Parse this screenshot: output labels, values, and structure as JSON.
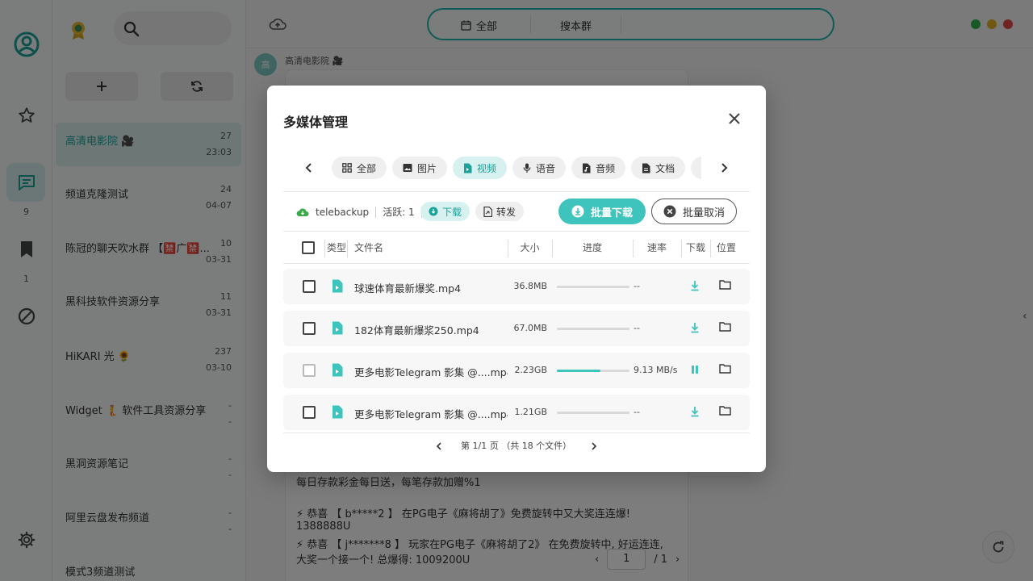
{
  "rail": {
    "chat_count": "9",
    "saved_count": "1"
  },
  "chatlist": {
    "items": [
      {
        "name": "高清电影院 🎥",
        "count": "27",
        "time": "23:03"
      },
      {
        "name": "频道克隆测试",
        "count": "24",
        "time": "04-07"
      },
      {
        "name": "陈冠的聊天吹水群 【🈲广🈲...",
        "count": "10",
        "time": "03-31"
      },
      {
        "name": "黑科技软件资源分享",
        "count": "11",
        "time": "03-31"
      },
      {
        "name": "HiKARI 光 🌻",
        "count": "237",
        "time": "03-10"
      },
      {
        "name": "Widget 🧜 软件工具资源分享",
        "count": "-",
        "time": "-"
      },
      {
        "name": "黑洞资源笔记",
        "count": "-",
        "time": "-"
      },
      {
        "name": "阿里云盘发布频道",
        "count": "-",
        "time": "-"
      },
      {
        "name": "模式3频道测试",
        "count": "",
        "time": ""
      }
    ]
  },
  "topbar": {
    "filter_all": "全部",
    "search_group": "搜本群"
  },
  "colors": {
    "accent": "#3ec4bc",
    "accent_dark": "#1aa29b",
    "win_green": "#2db34a",
    "win_yellow": "#e0b020",
    "win_red": "#e04848"
  },
  "message": {
    "sender": "高清电影院 🎥",
    "avatar_text": "高",
    "lines": [
      "每日存款彩金每日送，每笔存款加赠%1",
      "⚡ 恭喜 【 b*****2 】 在PG电子《麻将胡了》免费旋转中又大奖连连爆!",
      "1388888U",
      "⚡ 恭喜 【 j*******8 】 玩家在PG电子《麻将胡了2》 在免费旋转中, 好运连连,",
      "大奖一个接一个! 总爆得: 1009200U"
    ],
    "page_value": "1",
    "page_total": "/ 1"
  },
  "modal": {
    "title": "多媒体管理",
    "tabs": [
      {
        "label": "全部",
        "icon": "grid-icon"
      },
      {
        "label": "图片",
        "icon": "image-icon"
      },
      {
        "label": "视频",
        "icon": "video-file-icon",
        "active": true
      },
      {
        "label": "语音",
        "icon": "mic-icon"
      },
      {
        "label": "音频",
        "icon": "audio-file-icon"
      },
      {
        "label": "文档",
        "icon": "document-icon"
      }
    ],
    "account": "telebackup",
    "active_label": "活跃: 1",
    "chip_download": "下载",
    "chip_forward": "转发",
    "batch_download": "批量下载",
    "batch_cancel": "批量取消",
    "columns": {
      "type": "类型",
      "name": "文件名",
      "size": "大小",
      "progress": "进度",
      "speed": "速率",
      "download": "下载",
      "location": "位置"
    },
    "files": [
      {
        "name": "球速体育最新爆奖.mp4",
        "size": "36.8MB",
        "progress": 0,
        "speed": "--",
        "state": "download"
      },
      {
        "name": "182体育最新爆浆250.mp4",
        "size": "67.0MB",
        "progress": 0,
        "speed": "--",
        "state": "download"
      },
      {
        "name": "更多电影Telegram 影集 @....mp4",
        "size": "2.23GB",
        "progress": 0.6,
        "speed": "9.13 MB/s",
        "state": "pause"
      },
      {
        "name": "更多电影Telegram 影集 @....mp4",
        "size": "1.21GB",
        "progress": 0,
        "speed": "--",
        "state": "download"
      }
    ],
    "pagination": "第 1/1 页 （共 18 个文件）"
  }
}
